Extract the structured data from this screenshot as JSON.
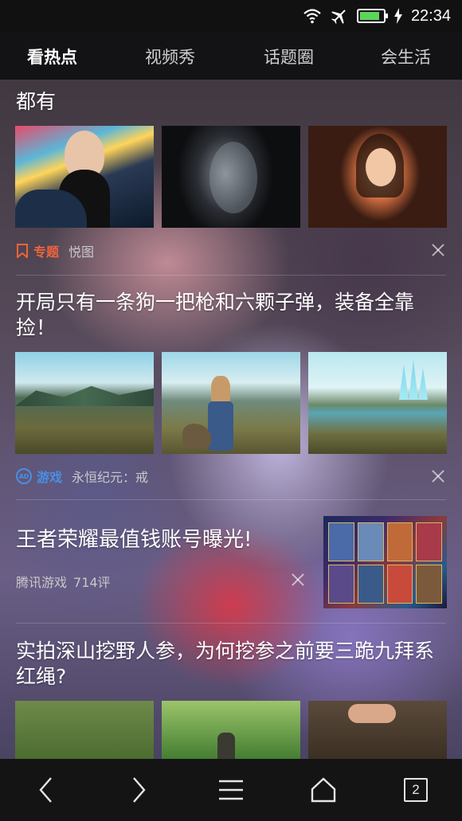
{
  "status_bar": {
    "time": "22:34",
    "icons": [
      "wifi-icon",
      "airplane-mode-icon",
      "battery-icon",
      "charging-icon"
    ],
    "battery_level": 0.85
  },
  "tabs": [
    {
      "label": "看热点",
      "active": true
    },
    {
      "label": "视频秀",
      "active": false
    },
    {
      "label": "话题圈",
      "active": false
    },
    {
      "label": "会生活",
      "active": false
    }
  ],
  "feed": {
    "item1": {
      "title": "都有",
      "tag": "专题",
      "source": "悦图",
      "tag_color": "#f0643a"
    },
    "item2": {
      "title": "开局只有一条狗一把枪和六颗子弹，装备全靠捡！",
      "tag": "游戏",
      "source": "永恒纪元：戒",
      "tag_color": "#4a8ee6",
      "ad_badge": "AD"
    },
    "item3": {
      "title": "王者荣耀最值钱账号曝光!",
      "source": "腾讯游戏",
      "comments": "714评"
    },
    "item4": {
      "title": "实拍深山挖野人参，为何挖参之前要三跪九拜系红绳?"
    }
  },
  "bottom_nav": {
    "tab_count": "2",
    "icons": [
      "back-icon",
      "forward-icon",
      "menu-icon",
      "home-icon",
      "tabs-icon"
    ]
  },
  "colors": {
    "topbar": "#121214",
    "navbar": "#141414",
    "accent_topic": "#f0643a",
    "accent_game": "#4a8ee6"
  }
}
